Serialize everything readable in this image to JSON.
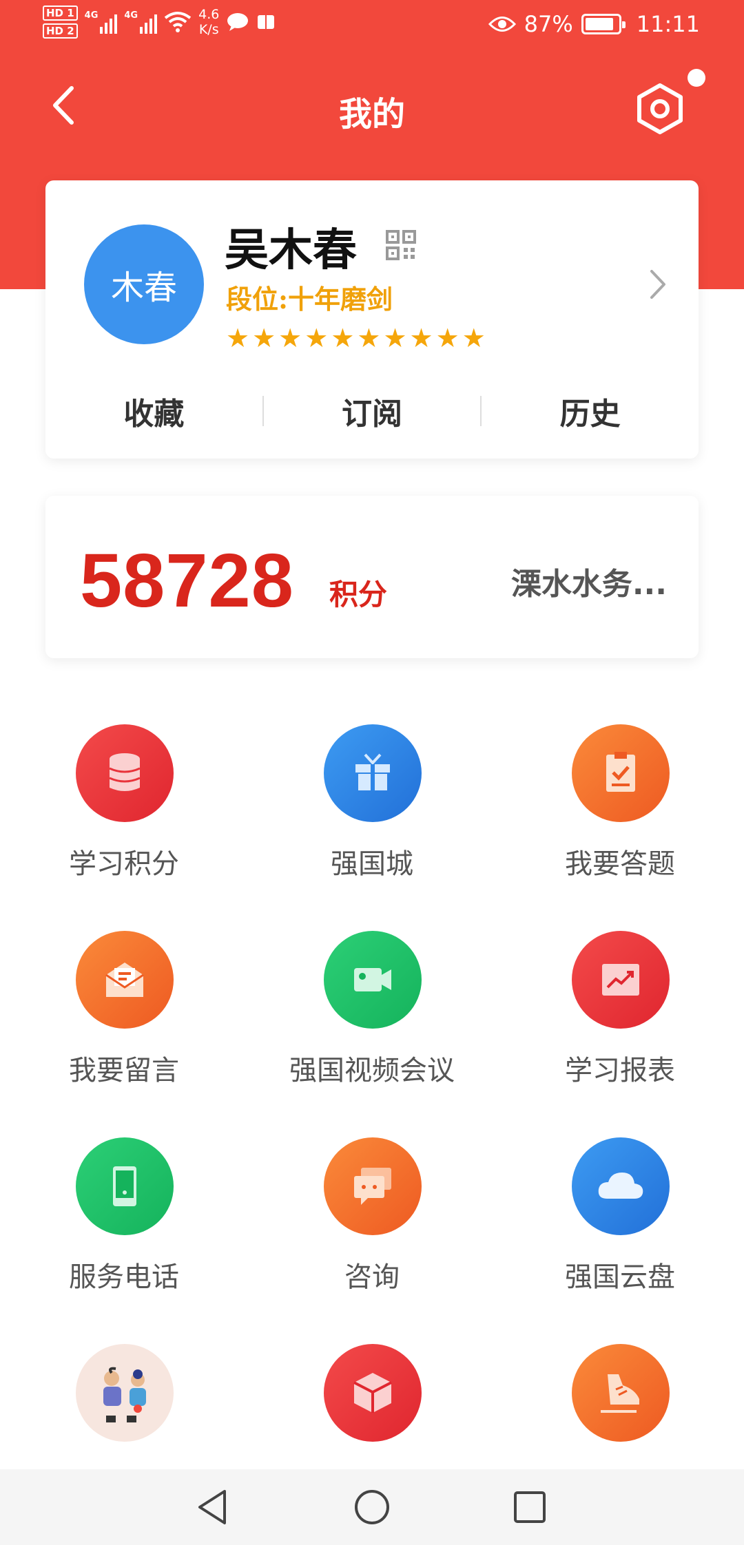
{
  "status_bar": {
    "hd1": "HD 1",
    "hd2": "HD 2",
    "net1": "4G",
    "net2": "4G",
    "speed_value": "4.6",
    "speed_unit": "K/s",
    "battery_percent": "87%",
    "time": "11:11",
    "battery_level": 0.87
  },
  "header": {
    "title": "我的"
  },
  "profile": {
    "avatar_text": "木春",
    "name": "吴木春",
    "rank": "段位:十年磨剑",
    "stars": 10,
    "links": [
      {
        "label": "收藏"
      },
      {
        "label": "订阅"
      },
      {
        "label": "历史"
      }
    ]
  },
  "points": {
    "value": "58728",
    "unit": "积分",
    "org": "溧水水务..."
  },
  "grid": [
    {
      "label": "学习积分",
      "icon": "database-icon",
      "color": "#e8333a"
    },
    {
      "label": "强国城",
      "icon": "gift-icon",
      "color": "#2e86e8"
    },
    {
      "label": "我要答题",
      "icon": "clipboard-check-icon",
      "color": "#f26a2e"
    },
    {
      "label": "我要留言",
      "icon": "mail-icon",
      "color": "#f26a2e"
    },
    {
      "label": "强国视频会议",
      "icon": "video-camera-icon",
      "color": "#22c06a"
    },
    {
      "label": "学习报表",
      "icon": "chart-icon",
      "color": "#e8333a"
    },
    {
      "label": "服务电话",
      "icon": "phone-icon",
      "color": "#22c06a"
    },
    {
      "label": "咨询",
      "icon": "chat-icon",
      "color": "#f26a2e"
    },
    {
      "label": "强国云盘",
      "icon": "cloud-icon",
      "color": "#2e86e8"
    },
    {
      "label": "",
      "icon": "family-illustration-icon",
      "color": "#f7e6df"
    },
    {
      "label": "",
      "icon": "cube-icon",
      "color": "#e8333a"
    },
    {
      "label": "",
      "icon": "sneaker-icon",
      "color": "#f26a2e"
    }
  ]
}
